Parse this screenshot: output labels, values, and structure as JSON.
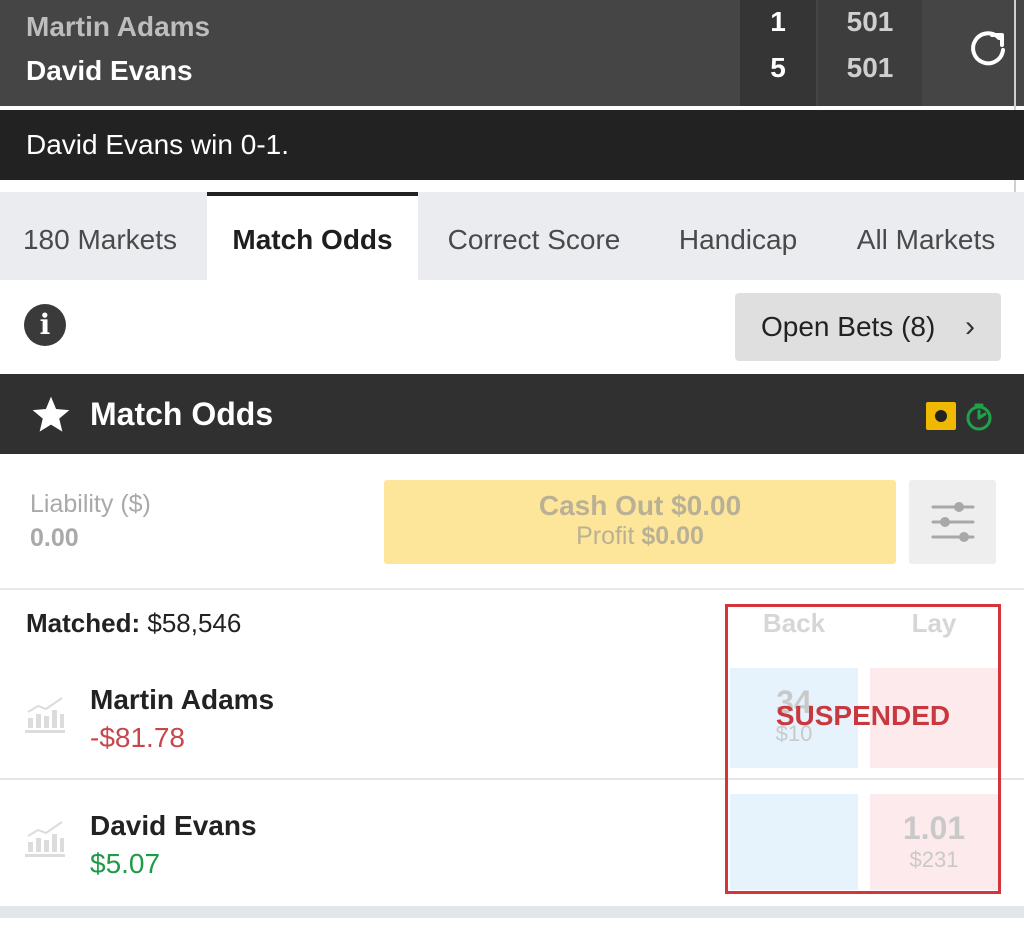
{
  "scoreboard": {
    "players": [
      {
        "name": "Martin Adams",
        "sets": "1",
        "score": "501"
      },
      {
        "name": "David Evans",
        "sets": "5",
        "score": "501"
      }
    ]
  },
  "ticker": {
    "text": "David Evans win 0-1."
  },
  "tabs": [
    {
      "label": "180 Markets"
    },
    {
      "label": "Match Odds"
    },
    {
      "label": "Correct Score"
    },
    {
      "label": "Handicap"
    },
    {
      "label": "All Markets"
    }
  ],
  "open_bets": {
    "label": "Open Bets (8)"
  },
  "market": {
    "title": "Match Odds"
  },
  "cashout": {
    "liability_label": "Liability ($)",
    "liability_value": "0.00",
    "cash_out_label": "Cash Out $0.00",
    "profit_label": "Profit",
    "profit_value": "$0.00"
  },
  "matched": {
    "label": "Matched:",
    "value": "$58,546"
  },
  "columns": {
    "back": "Back",
    "lay": "Lay"
  },
  "runners": [
    {
      "name": "Martin Adams",
      "pl": "-$81.78",
      "back_odds": "34",
      "back_size": "$10",
      "lay_odds": "",
      "lay_size": ""
    },
    {
      "name": "David Evans",
      "pl": "$5.07",
      "back_odds": "",
      "back_size": "",
      "lay_odds": "1.01",
      "lay_size": "$231"
    }
  ],
  "status": {
    "suspended": "SUSPENDED"
  },
  "colors": {
    "accent_yellow": "#f0b800",
    "suspended_red": "#d3353b",
    "negative": "#c8474d",
    "positive": "#1f9a48"
  }
}
